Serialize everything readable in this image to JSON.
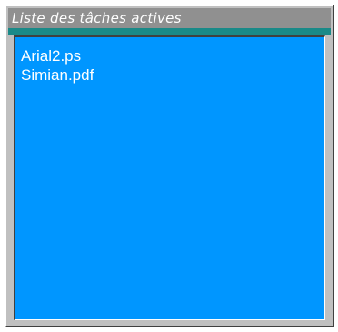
{
  "panel": {
    "title": "Liste des tâches actives"
  },
  "task_list": {
    "items": [
      {
        "label": "Arial2.ps"
      },
      {
        "label": "Simian.pdf"
      }
    ]
  },
  "colors": {
    "title_bar": "#909090",
    "accent_strip": "#1a8a88",
    "list_background": "#0096ff",
    "text": "#ffffff",
    "frame": "#c0c0c0"
  }
}
